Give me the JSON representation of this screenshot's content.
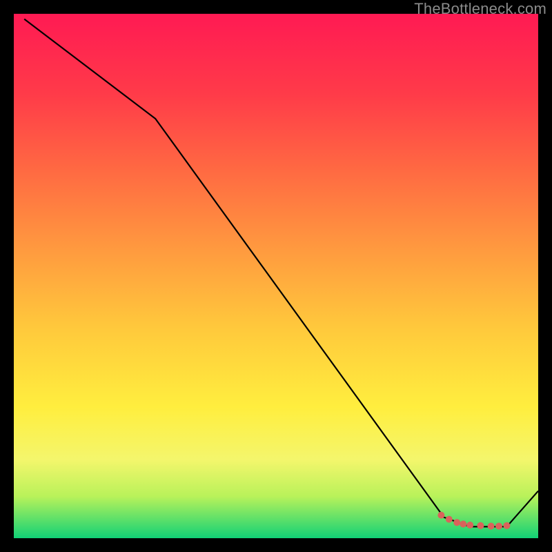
{
  "watermark": "TheBottleneck.com",
  "chart_data": {
    "type": "line",
    "title": "",
    "xlabel": "",
    "ylabel": "",
    "xlim": [
      0,
      100
    ],
    "ylim": [
      0,
      100
    ],
    "grid": false,
    "gradient": {
      "stops": [
        {
          "offset": 0,
          "color": "#11d176"
        },
        {
          "offset": 8,
          "color": "#b9f25a"
        },
        {
          "offset": 15,
          "color": "#f4f66c"
        },
        {
          "offset": 25,
          "color": "#ffee3e"
        },
        {
          "offset": 40,
          "color": "#ffc93c"
        },
        {
          "offset": 55,
          "color": "#ff9a3f"
        },
        {
          "offset": 70,
          "color": "#ff6a42"
        },
        {
          "offset": 85,
          "color": "#ff3a49"
        },
        {
          "offset": 100,
          "color": "#ff1a53"
        }
      ]
    },
    "series": [
      {
        "name": "curve",
        "color": "#000000",
        "points": [
          {
            "x": 2,
            "y": 99
          },
          {
            "x": 27,
            "y": 80
          },
          {
            "x": 82,
            "y": 4
          },
          {
            "x": 87,
            "y": 2.2
          },
          {
            "x": 94,
            "y": 2.2
          },
          {
            "x": 100,
            "y": 9
          }
        ]
      }
    ],
    "markers": {
      "name": "dots",
      "color": "#d9635b",
      "points": [
        {
          "x": 81.5,
          "y": 4.4
        },
        {
          "x": 83.0,
          "y": 3.6
        },
        {
          "x": 84.5,
          "y": 3.0
        },
        {
          "x": 85.7,
          "y": 2.7
        },
        {
          "x": 87.0,
          "y": 2.5
        },
        {
          "x": 89.0,
          "y": 2.4
        },
        {
          "x": 91.0,
          "y": 2.3
        },
        {
          "x": 92.5,
          "y": 2.3
        },
        {
          "x": 94.0,
          "y": 2.4
        }
      ]
    }
  }
}
